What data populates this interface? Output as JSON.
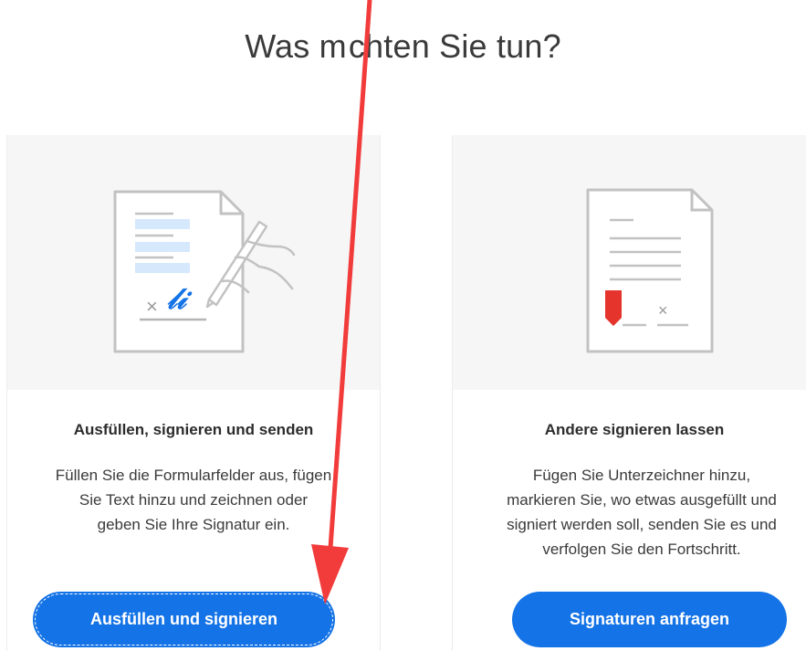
{
  "heading": {
    "part1": "Was m",
    "part2": "chten Sie tun?"
  },
  "cards": [
    {
      "title": "Ausfüllen, signieren und senden",
      "description": [
        "Füllen Sie die Formularfelder aus, fügen",
        "Sie Text hinzu und zeichnen oder",
        "geben Sie Ihre Signatur ein."
      ],
      "button": "Ausfüllen und signieren",
      "illustration": {
        "mark": "×",
        "signature": "𝓁𝒾"
      }
    },
    {
      "title": "Andere signieren lassen",
      "description": [
        "Fügen Sie Unterzeichner hinzu,",
        "markieren Sie, wo etwas ausgefüllt und",
        "signiert werden soll, senden Sie es und",
        "verfolgen Sie den Fortschritt."
      ],
      "button": "Signaturen anfragen",
      "illustration": {
        "mark": "×"
      }
    }
  ],
  "colors": {
    "accent": "#1473e6",
    "arrow": "#f23b3b",
    "marker": "#e5342b"
  },
  "icons": [
    "document-sign-icon",
    "pen-hand-icon",
    "document-request-icon",
    "bookmark-marker-icon"
  ]
}
